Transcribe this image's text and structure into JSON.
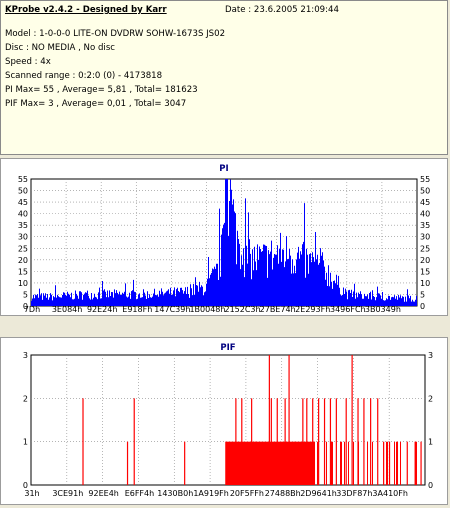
{
  "header": {
    "title": "KProbe v2.4.2 - Designed by Karr",
    "date": "Date : 23.6.2005 21:09:44",
    "lines": [
      "Model : 1-0-0-0 LITE-ON DVDRW SOHW-1673S JS02",
      "Disc : NO MEDIA , No disc",
      "Speed : 4x",
      "Scanned range : 0:2:0 (0) - 4173818",
      "PI Max= 55 , Average= 5,81 , Total= 181623",
      "PIF Max= 3 , Average= 0,01 , Total= 3047"
    ]
  },
  "chart_data": [
    {
      "type": "area",
      "title": "PI",
      "ylim": [
        0,
        55
      ],
      "y_ticks": [
        0,
        5,
        10,
        15,
        20,
        25,
        30,
        35,
        40,
        45,
        50,
        55
      ],
      "x_ticks": [
        "7Dh",
        "3E084h",
        "92E24h",
        "E918Fh",
        "147C39h",
        "1B0048h",
        "2152C3h",
        "27BE74h",
        "2E293Fh",
        "3496FCh",
        "3B0349h"
      ],
      "grid": true,
      "color": "#0000ff",
      "profile": [
        [
          0,
          4
        ],
        [
          0.05,
          4
        ],
        [
          0.15,
          5
        ],
        [
          0.3,
          5
        ],
        [
          0.4,
          6
        ],
        [
          0.45,
          8
        ],
        [
          0.48,
          14
        ],
        [
          0.495,
          24
        ],
        [
          0.505,
          50
        ],
        [
          0.515,
          46
        ],
        [
          0.53,
          30
        ],
        [
          0.56,
          20
        ],
        [
          0.6,
          20
        ],
        [
          0.65,
          23
        ],
        [
          0.68,
          22
        ],
        [
          0.72,
          18
        ],
        [
          0.76,
          16
        ],
        [
          0.79,
          10
        ],
        [
          0.82,
          5
        ],
        [
          0.9,
          4
        ],
        [
          1.0,
          3
        ]
      ],
      "max": 55,
      "max_at": 0.505
    },
    {
      "type": "bar",
      "title": "PIF",
      "ylim": [
        0,
        3
      ],
      "y_ticks": [
        0,
        1,
        2,
        3
      ],
      "x_ticks": [
        "31h",
        "3CE91h",
        "92EE4h",
        "E6FF4h",
        "1430B0h",
        "1A919Fh",
        "20F5FFh",
        "27488Bh",
        "2D9641h",
        "33DF87h",
        "3A410Fh"
      ],
      "grid": true,
      "color": "#ff0000",
      "spikes": [
        [
          0.132,
          2
        ],
        [
          0.245,
          1
        ],
        [
          0.262,
          2
        ],
        [
          0.39,
          1
        ],
        [
          0.52,
          2
        ],
        [
          0.535,
          2
        ],
        [
          0.56,
          2
        ],
        [
          0.57,
          1
        ],
        [
          0.605,
          3
        ],
        [
          0.61,
          2
        ],
        [
          0.625,
          2
        ],
        [
          0.645,
          2
        ],
        [
          0.655,
          3
        ],
        [
          0.67,
          1
        ],
        [
          0.69,
          2
        ],
        [
          0.7,
          2
        ],
        [
          0.715,
          2
        ],
        [
          0.73,
          2
        ],
        [
          0.745,
          2
        ],
        [
          0.76,
          2
        ],
        [
          0.775,
          2
        ],
        [
          0.8,
          2
        ],
        [
          0.815,
          3
        ],
        [
          0.83,
          2
        ],
        [
          0.845,
          2
        ],
        [
          0.862,
          2
        ],
        [
          0.88,
          2
        ],
        [
          0.895,
          1
        ],
        [
          0.91,
          1
        ],
        [
          0.93,
          1
        ],
        [
          0.955,
          1
        ],
        [
          0.975,
          1
        ],
        [
          0.99,
          1
        ]
      ],
      "dense_band": [
        0.493,
        0.72,
        1
      ]
    }
  ]
}
